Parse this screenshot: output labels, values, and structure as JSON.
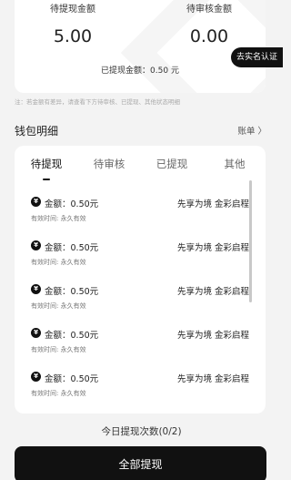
{
  "summary": {
    "pending_withdraw_label": "待提现金额",
    "pending_withdraw_value": "5.00",
    "under_review_label": "待审核金额",
    "under_review_value": "0.00",
    "withdrawn_label": "已提现金额：",
    "withdrawn_value": "0.50 元"
  },
  "realname_button": "去实名认证",
  "note": "注：若金额有差异，请查看下方待审核、已提现、其他状态明细",
  "wallet": {
    "title": "钱包明细",
    "ledger_link": "账单 〉"
  },
  "tabs": [
    {
      "label": "待提现",
      "active": true
    },
    {
      "label": "待审核",
      "active": false
    },
    {
      "label": "已提现",
      "active": false
    },
    {
      "label": "其他",
      "active": false
    }
  ],
  "records": [
    {
      "icon": "yen-coin-icon",
      "amount": "金额：0.50元",
      "source": "先享为境 金彩启程",
      "validity": "有效时间: 永久有效"
    },
    {
      "icon": "yen-coin-icon",
      "amount": "金额：0.50元",
      "source": "先享为境 金彩启程",
      "validity": "有效时间: 永久有效"
    },
    {
      "icon": "yen-coin-icon",
      "amount": "金额：0.50元",
      "source": "先享为境 金彩启程",
      "validity": "有效时间: 永久有效"
    },
    {
      "icon": "yen-coin-icon",
      "amount": "金额：0.50元",
      "source": "先享为境 金彩启程",
      "validity": "有效时间: 永久有效"
    },
    {
      "icon": "yen-coin-icon",
      "amount": "金额：0.50元",
      "source": "先享为境 金彩启程",
      "validity": "有效时间: 永久有效"
    }
  ],
  "today_count": "今日提现次数(0/2)",
  "withdraw_all_button": "全部提现",
  "colors": {
    "primary": "#111111",
    "background": "#f3f3f3",
    "card": "#ffffff"
  }
}
